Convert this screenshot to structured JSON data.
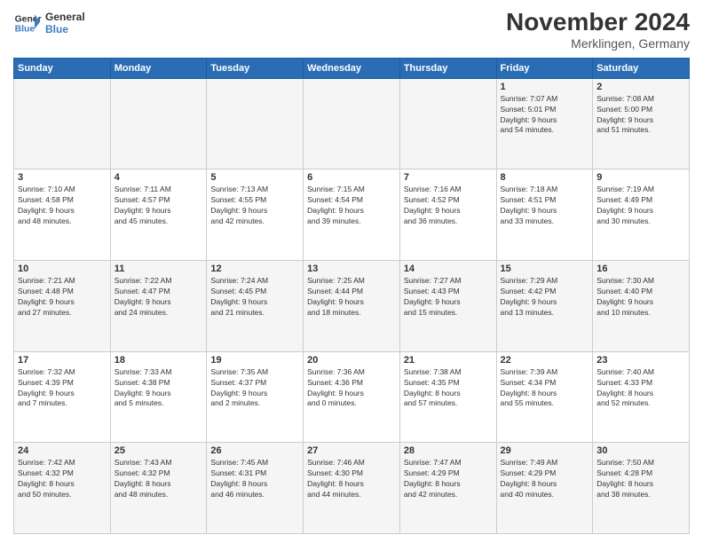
{
  "logo": {
    "line1": "General",
    "line2": "Blue"
  },
  "title": "November 2024",
  "location": "Merklingen, Germany",
  "days_of_week": [
    "Sunday",
    "Monday",
    "Tuesday",
    "Wednesday",
    "Thursday",
    "Friday",
    "Saturday"
  ],
  "weeks": [
    [
      {
        "day": "",
        "info": ""
      },
      {
        "day": "",
        "info": ""
      },
      {
        "day": "",
        "info": ""
      },
      {
        "day": "",
        "info": ""
      },
      {
        "day": "",
        "info": ""
      },
      {
        "day": "1",
        "info": "Sunrise: 7:07 AM\nSunset: 5:01 PM\nDaylight: 9 hours\nand 54 minutes."
      },
      {
        "day": "2",
        "info": "Sunrise: 7:08 AM\nSunset: 5:00 PM\nDaylight: 9 hours\nand 51 minutes."
      }
    ],
    [
      {
        "day": "3",
        "info": "Sunrise: 7:10 AM\nSunset: 4:58 PM\nDaylight: 9 hours\nand 48 minutes."
      },
      {
        "day": "4",
        "info": "Sunrise: 7:11 AM\nSunset: 4:57 PM\nDaylight: 9 hours\nand 45 minutes."
      },
      {
        "day": "5",
        "info": "Sunrise: 7:13 AM\nSunset: 4:55 PM\nDaylight: 9 hours\nand 42 minutes."
      },
      {
        "day": "6",
        "info": "Sunrise: 7:15 AM\nSunset: 4:54 PM\nDaylight: 9 hours\nand 39 minutes."
      },
      {
        "day": "7",
        "info": "Sunrise: 7:16 AM\nSunset: 4:52 PM\nDaylight: 9 hours\nand 36 minutes."
      },
      {
        "day": "8",
        "info": "Sunrise: 7:18 AM\nSunset: 4:51 PM\nDaylight: 9 hours\nand 33 minutes."
      },
      {
        "day": "9",
        "info": "Sunrise: 7:19 AM\nSunset: 4:49 PM\nDaylight: 9 hours\nand 30 minutes."
      }
    ],
    [
      {
        "day": "10",
        "info": "Sunrise: 7:21 AM\nSunset: 4:48 PM\nDaylight: 9 hours\nand 27 minutes."
      },
      {
        "day": "11",
        "info": "Sunrise: 7:22 AM\nSunset: 4:47 PM\nDaylight: 9 hours\nand 24 minutes."
      },
      {
        "day": "12",
        "info": "Sunrise: 7:24 AM\nSunset: 4:45 PM\nDaylight: 9 hours\nand 21 minutes."
      },
      {
        "day": "13",
        "info": "Sunrise: 7:25 AM\nSunset: 4:44 PM\nDaylight: 9 hours\nand 18 minutes."
      },
      {
        "day": "14",
        "info": "Sunrise: 7:27 AM\nSunset: 4:43 PM\nDaylight: 9 hours\nand 15 minutes."
      },
      {
        "day": "15",
        "info": "Sunrise: 7:29 AM\nSunset: 4:42 PM\nDaylight: 9 hours\nand 13 minutes."
      },
      {
        "day": "16",
        "info": "Sunrise: 7:30 AM\nSunset: 4:40 PM\nDaylight: 9 hours\nand 10 minutes."
      }
    ],
    [
      {
        "day": "17",
        "info": "Sunrise: 7:32 AM\nSunset: 4:39 PM\nDaylight: 9 hours\nand 7 minutes."
      },
      {
        "day": "18",
        "info": "Sunrise: 7:33 AM\nSunset: 4:38 PM\nDaylight: 9 hours\nand 5 minutes."
      },
      {
        "day": "19",
        "info": "Sunrise: 7:35 AM\nSunset: 4:37 PM\nDaylight: 9 hours\nand 2 minutes."
      },
      {
        "day": "20",
        "info": "Sunrise: 7:36 AM\nSunset: 4:36 PM\nDaylight: 9 hours\nand 0 minutes."
      },
      {
        "day": "21",
        "info": "Sunrise: 7:38 AM\nSunset: 4:35 PM\nDaylight: 8 hours\nand 57 minutes."
      },
      {
        "day": "22",
        "info": "Sunrise: 7:39 AM\nSunset: 4:34 PM\nDaylight: 8 hours\nand 55 minutes."
      },
      {
        "day": "23",
        "info": "Sunrise: 7:40 AM\nSunset: 4:33 PM\nDaylight: 8 hours\nand 52 minutes."
      }
    ],
    [
      {
        "day": "24",
        "info": "Sunrise: 7:42 AM\nSunset: 4:32 PM\nDaylight: 8 hours\nand 50 minutes."
      },
      {
        "day": "25",
        "info": "Sunrise: 7:43 AM\nSunset: 4:32 PM\nDaylight: 8 hours\nand 48 minutes."
      },
      {
        "day": "26",
        "info": "Sunrise: 7:45 AM\nSunset: 4:31 PM\nDaylight: 8 hours\nand 46 minutes."
      },
      {
        "day": "27",
        "info": "Sunrise: 7:46 AM\nSunset: 4:30 PM\nDaylight: 8 hours\nand 44 minutes."
      },
      {
        "day": "28",
        "info": "Sunrise: 7:47 AM\nSunset: 4:29 PM\nDaylight: 8 hours\nand 42 minutes."
      },
      {
        "day": "29",
        "info": "Sunrise: 7:49 AM\nSunset: 4:29 PM\nDaylight: 8 hours\nand 40 minutes."
      },
      {
        "day": "30",
        "info": "Sunrise: 7:50 AM\nSunset: 4:28 PM\nDaylight: 8 hours\nand 38 minutes."
      }
    ]
  ]
}
